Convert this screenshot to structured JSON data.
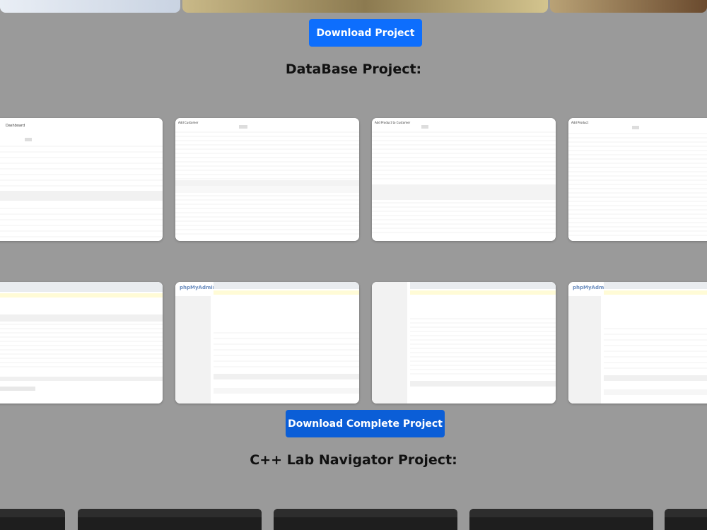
{
  "buttons": {
    "download_project": "Download Project",
    "download_complete": "Download Complete Project"
  },
  "sections": {
    "database": "DataBase Project:",
    "cpp_lab": "C++ Lab Navigator Project:"
  },
  "colors": {
    "background": "#9a9a9a",
    "primary_button": "#0d6efd",
    "complete_button": "#0b5ed7"
  },
  "gallery_rows": [
    {
      "kind": "database-tables",
      "count": 4
    },
    {
      "kind": "phpmyadmin",
      "count": 4
    }
  ],
  "terminal_row": {
    "count": 5
  }
}
